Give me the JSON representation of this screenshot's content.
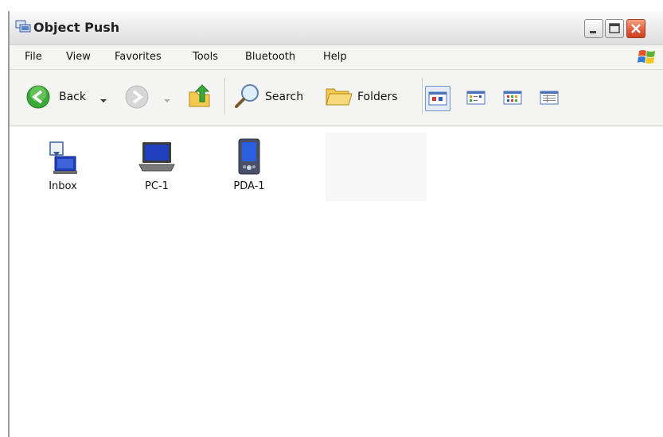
{
  "window": {
    "title": "Object Push"
  },
  "menu": [
    {
      "label": "File"
    },
    {
      "label": "View"
    },
    {
      "label": "Favorites"
    },
    {
      "label": "Tools"
    },
    {
      "label": "Bluetooth"
    },
    {
      "label": "Help"
    }
  ],
  "toolbar": {
    "back_label": "Back",
    "search_label": "Search",
    "folders_label": "Folders"
  },
  "items": [
    {
      "label": "Inbox",
      "icon": "inbox-icon"
    },
    {
      "label": "PC-1",
      "icon": "laptop-icon"
    },
    {
      "label": "PDA-1",
      "icon": "pda-icon"
    }
  ],
  "colors": {
    "back_green": "#3aa83a",
    "close_red": "#e35a3d",
    "device_blue": "#1f3fbf",
    "view_active_border": "#6f93c8"
  }
}
